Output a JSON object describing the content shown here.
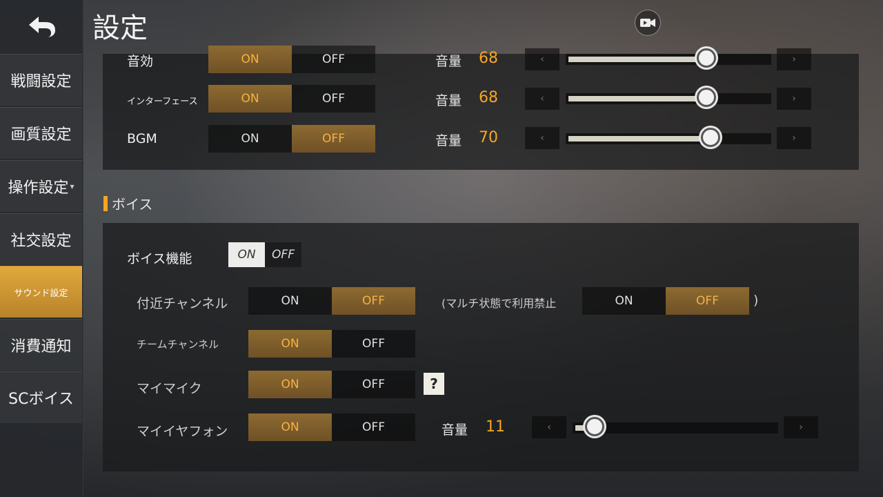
{
  "header": {
    "title": "設定",
    "camera_icon": "camera-record-icon"
  },
  "sidebar": {
    "back_icon": "back-arrow-icon",
    "items": [
      {
        "label": "戦闘設定"
      },
      {
        "label": "画質設定"
      },
      {
        "label": "操作設定",
        "caret": "▾"
      },
      {
        "label": "社交設定"
      },
      {
        "label": "サウンド設定",
        "active": true
      },
      {
        "label": "消費通知"
      },
      {
        "label": "SCボイス"
      }
    ]
  },
  "toggles": {
    "on": "ON",
    "off": "OFF"
  },
  "volume_label": "音量",
  "sound": [
    {
      "label": "音効",
      "state": "ON",
      "volume": "68"
    },
    {
      "label": "インターフェース",
      "state": "ON",
      "volume": "68"
    },
    {
      "label": "BGM",
      "state": "OFF",
      "volume": "70"
    }
  ],
  "voice": {
    "section_title": "ボイス",
    "voice_function": {
      "label": "ボイス機能",
      "state": "ON"
    },
    "nearby_channel": {
      "label": "付近チャンネル",
      "state": "OFF"
    },
    "multi_note": "(マルチ状態で利用禁止",
    "multi_note_close": ")",
    "multi_state": "OFF",
    "team_channel": {
      "label": "チームチャンネル",
      "state": "ON"
    },
    "my_mic": {
      "label": "マイマイク",
      "state": "ON"
    },
    "my_earphone": {
      "label": "マイイヤフォン",
      "state": "ON",
      "volume": "11"
    },
    "help": "?"
  },
  "arrows": {
    "left": "‹",
    "right": "›"
  },
  "colors": {
    "accent": "#f5a623",
    "active_tab": "#d39a34"
  }
}
